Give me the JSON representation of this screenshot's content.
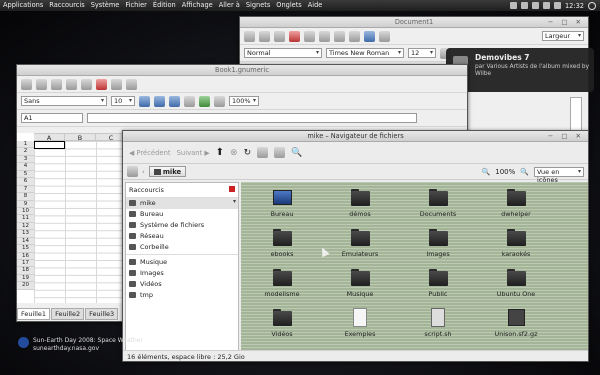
{
  "top_panel": {
    "menu": [
      "Applications",
      "Raccourcis",
      "Système",
      "Fichier",
      "Édition",
      "Affichage",
      "Aller à",
      "Signets",
      "Onglets",
      "Aide"
    ],
    "clock": "12:32"
  },
  "writer": {
    "title": "Document1",
    "style_value": "Normal",
    "font_value": "Times New Roman",
    "size_value": "12",
    "largeur_label": "Largeur"
  },
  "notification": {
    "title": "Demovibes 7",
    "body": "par Various Artists de l'album mixed by Wilbe"
  },
  "calc": {
    "title": "Book1.gnumeric",
    "font_value": "Sans",
    "size_value": "10",
    "zoom_value": "100%",
    "cell_ref": "A1",
    "columns": [
      "A",
      "B",
      "C"
    ],
    "rows": [
      "1",
      "2",
      "3",
      "4",
      "5",
      "6",
      "7",
      "8",
      "9",
      "10",
      "11",
      "12",
      "13",
      "14",
      "15",
      "16",
      "17",
      "18",
      "19",
      "20"
    ],
    "sheets": [
      "Feuille1",
      "Feuille2",
      "Feuille3"
    ]
  },
  "nautilus": {
    "title": "mike – Navigateur de fichiers",
    "back_label": "Précédent",
    "forward_label": "Suivant",
    "location": "mike",
    "zoom": "100%",
    "view_mode": "Vue en icônes",
    "sidebar_header": "Raccourcis",
    "sidebar_items": [
      "mike",
      "Bureau",
      "Système de fichiers",
      "Réseau",
      "Corbeille"
    ],
    "sidebar_bookmarks": [
      "Musique",
      "Images",
      "Vidéos",
      "tmp"
    ],
    "items": [
      {
        "name": "Bureau",
        "type": "desktop"
      },
      {
        "name": "démos",
        "type": "folder"
      },
      {
        "name": "Documents",
        "type": "folder"
      },
      {
        "name": "dwhelper",
        "type": "folder"
      },
      {
        "name": "ebooks",
        "type": "folder"
      },
      {
        "name": "Emulateurs",
        "type": "folder"
      },
      {
        "name": "Images",
        "type": "folder"
      },
      {
        "name": "karaokés",
        "type": "folder"
      },
      {
        "name": "modelisme",
        "type": "folder"
      },
      {
        "name": "Musique",
        "type": "folder"
      },
      {
        "name": "Public",
        "type": "folder"
      },
      {
        "name": "Ubuntu One",
        "type": "folder"
      },
      {
        "name": "Vidéos",
        "type": "folder"
      },
      {
        "name": "Exemples",
        "type": "doc"
      },
      {
        "name": "script.sh",
        "type": "script"
      },
      {
        "name": "Unison.sf2.gz",
        "type": "archive"
      }
    ],
    "status": "16 éléments, espace libre : 25,2 Gio"
  },
  "rss": {
    "line1": "Sun-Earth Day 2008: Space Weather",
    "line2": "sunearthday.nasa.gov"
  }
}
